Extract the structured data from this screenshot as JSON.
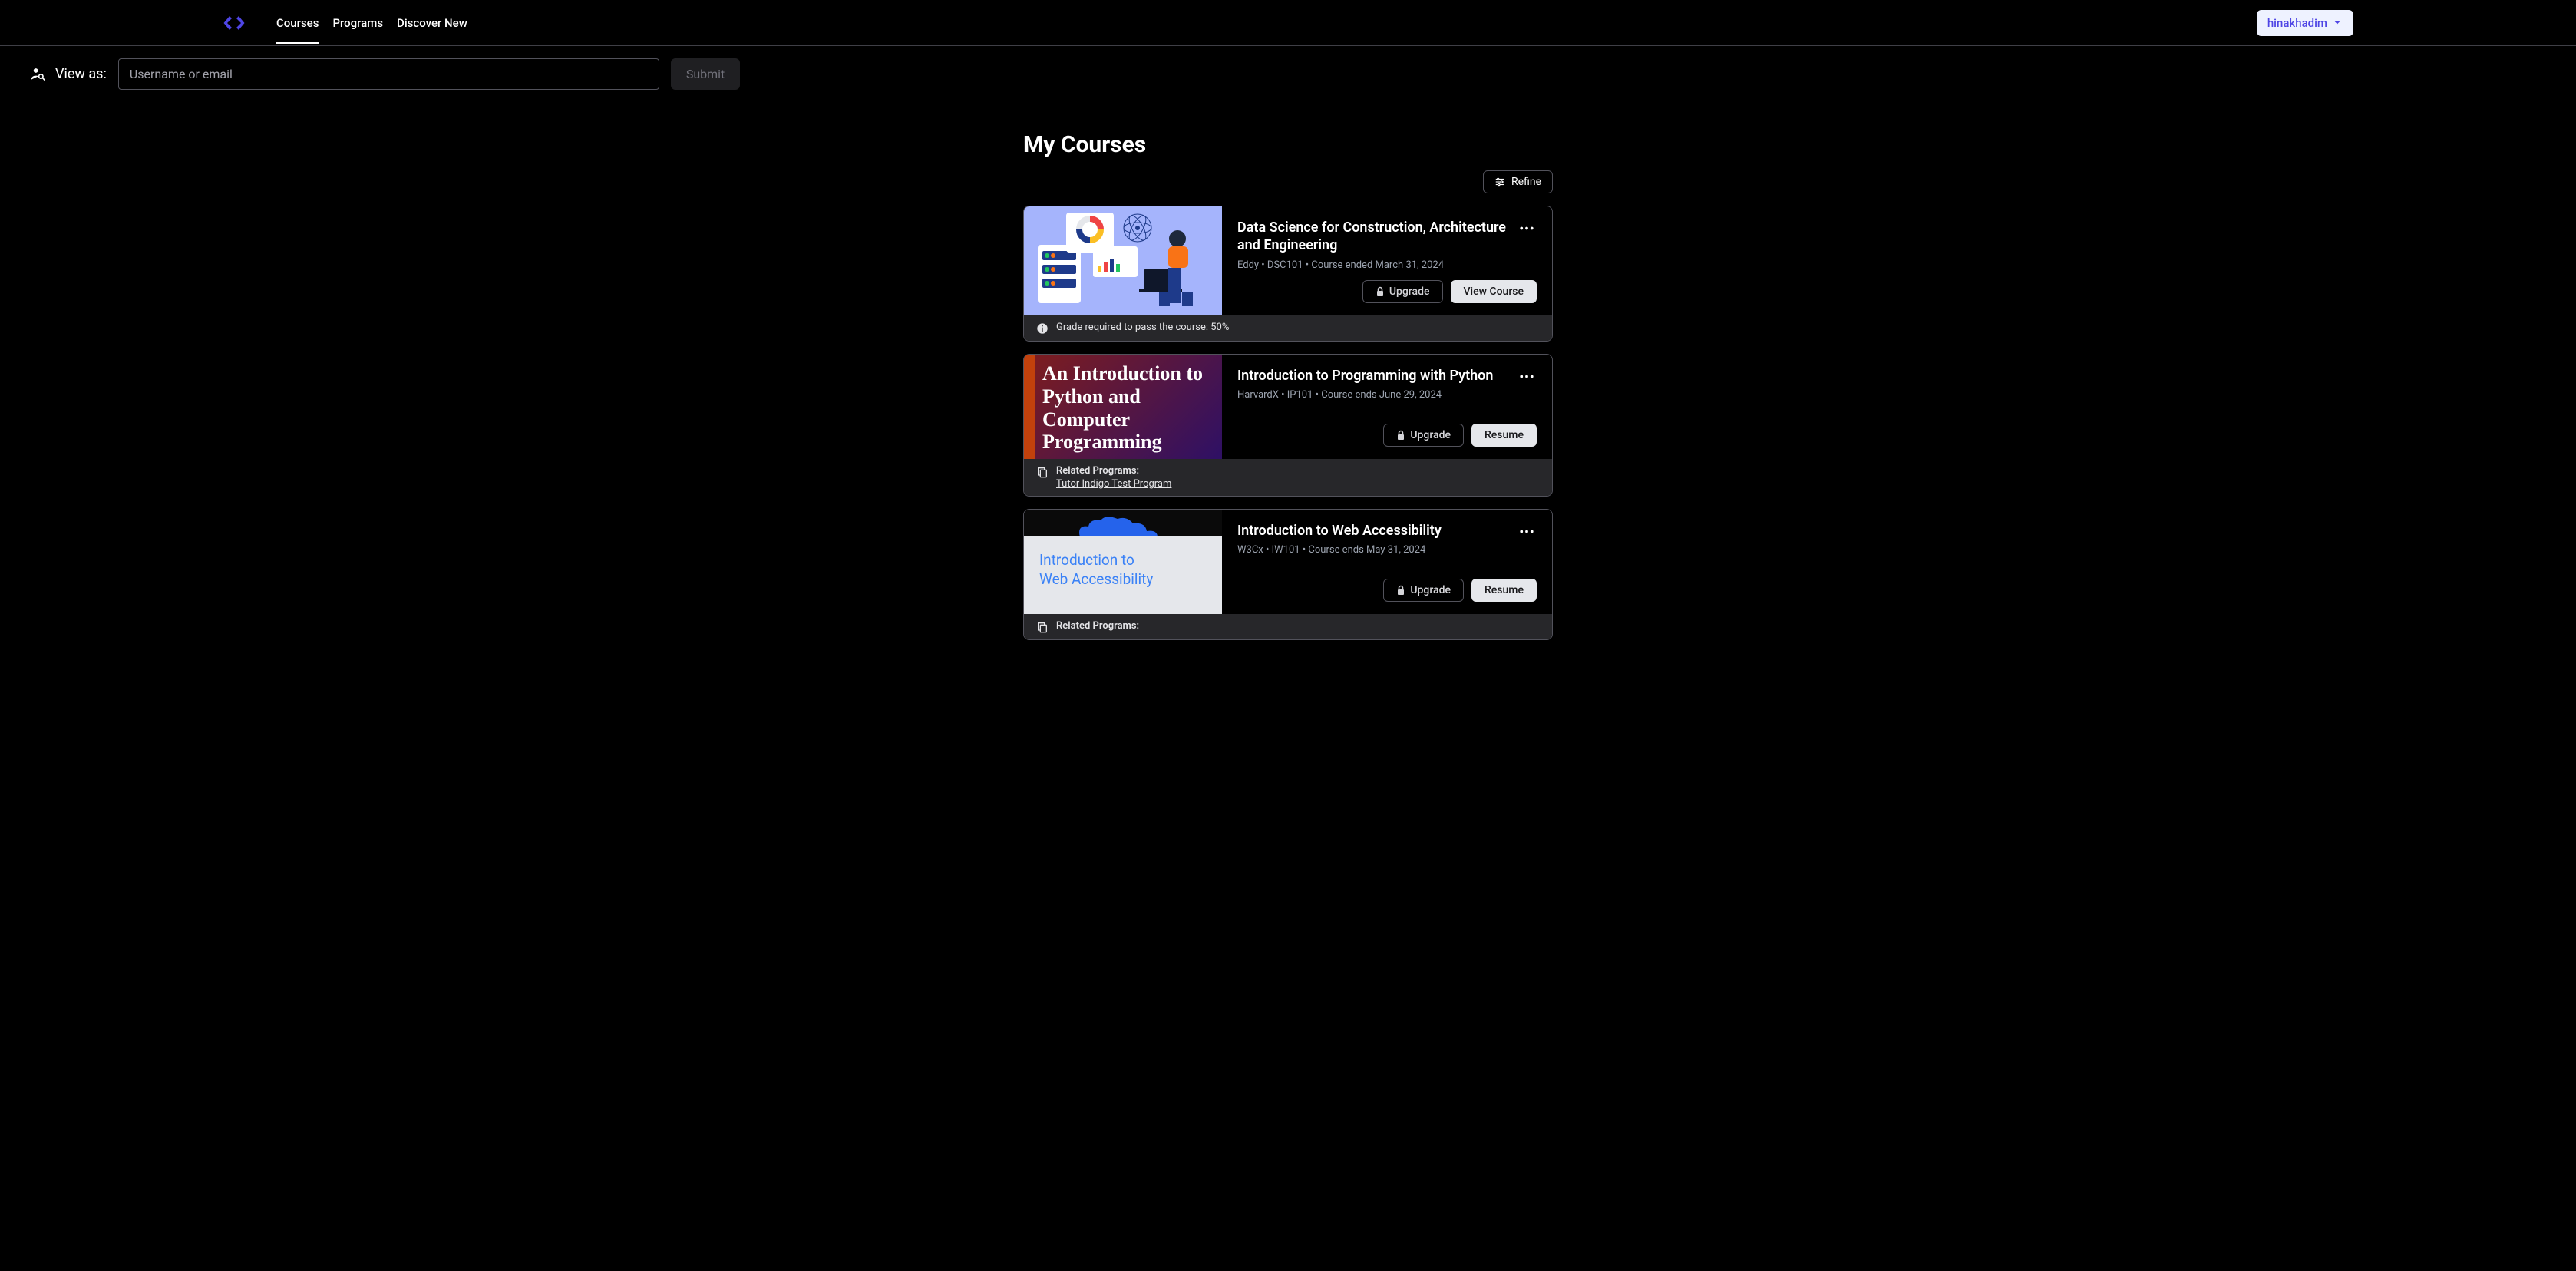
{
  "nav": {
    "links": [
      "Courses",
      "Programs",
      "Discover New"
    ],
    "active_index": 0,
    "user": "hinakhadim"
  },
  "view_as": {
    "label": "View as:",
    "placeholder": "Username or email",
    "submit": "Submit"
  },
  "page_title": "My Courses",
  "refine_label": "Refine",
  "buttons": {
    "upgrade": "Upgrade",
    "view_course": "View Course",
    "resume": "Resume"
  },
  "courses": [
    {
      "title": "Data Science for Construction, Architecture and Engineering",
      "meta": "Eddy • DSC101 • Course ended March 31, 2024",
      "primary_action": "view_course",
      "footer_type": "info",
      "footer_text": "Grade required to pass the course: 50%"
    },
    {
      "title": "Introduction to Programming with Python",
      "meta": "HarvardX • IP101 • Course ends June 29, 2024",
      "primary_action": "resume",
      "footer_type": "programs",
      "footer_label": "Related Programs:",
      "footer_link": "Tutor Indigo Test Program",
      "thumb_text": "An Introduction to Python and Computer Programming"
    },
    {
      "title": "Introduction to Web Accessibility",
      "meta": "W3Cx • IW101 • Course ends May 31, 2024",
      "primary_action": "resume",
      "footer_type": "programs",
      "footer_label": "Related Programs:",
      "thumb_line1": "Introduction to",
      "thumb_line2": "Web Accessibility"
    }
  ]
}
